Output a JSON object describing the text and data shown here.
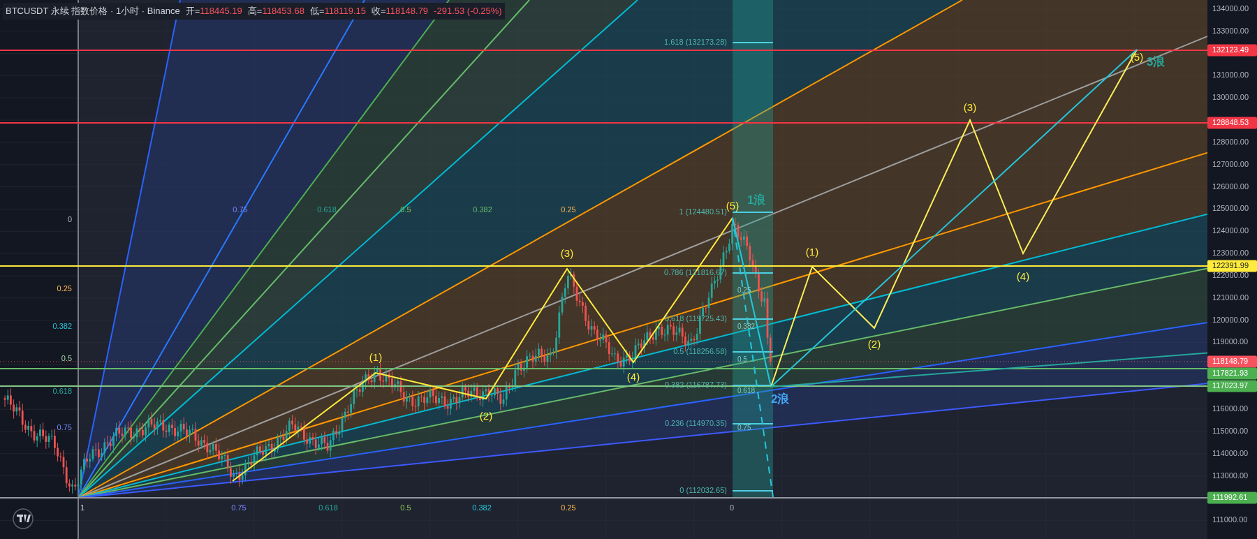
{
  "legend": {
    "title": "BTCUSDT 永续 指数价格 · 1小时 · Binance",
    "ohlc": [
      {
        "label": "开=",
        "value": "118445.19"
      },
      {
        "label": "高=",
        "value": "118453.68"
      },
      {
        "label": "低=",
        "value": "118119.15"
      },
      {
        "label": "收=",
        "value": "118148.79"
      }
    ],
    "change": "-291.53 (-0.25%)"
  },
  "price_axis": {
    "ticks": [
      "134000.00",
      "133000.00",
      "131000.00",
      "130000.00",
      "128000.00",
      "127000.00",
      "126000.00",
      "125000.00",
      "124000.00",
      "123000.00",
      "122000.00",
      "121000.00",
      "120000.00",
      "119000.00",
      "116000.00",
      "115000.00",
      "114000.00",
      "113000.00",
      "111000.00"
    ],
    "badges": [
      {
        "value": "132123.49",
        "color": "#f23645"
      },
      {
        "value": "128848.53",
        "color": "#f23645"
      },
      {
        "value": "122391.99",
        "color": "#ffeb3b"
      },
      {
        "value": "118148.79",
        "color": "#f7525f"
      },
      {
        "value": "117821.93",
        "color": "#4caf50"
      },
      {
        "value": "117023.97",
        "color": "#4caf50"
      },
      {
        "value": "111992.61",
        "color": "#4caf50"
      }
    ]
  },
  "gann_box": {
    "top_labels": [
      "0.75",
      "0.618",
      "0.5",
      "0.382",
      "0.25"
    ],
    "left_labels": [
      "0",
      "0.25",
      "0.382",
      "0.5",
      "0.618",
      "0.75"
    ],
    "bottom_labels": [
      "1",
      "0.75",
      "0.618",
      "0.5",
      "0.382",
      "0.25",
      "0"
    ]
  },
  "fib_retracement": {
    "levels": [
      "1.618 (132173.28)",
      "1 (124480.51)",
      "0.786 (121816.67)",
      "0.618 (119725.43)",
      "0.5 (118256.58)",
      "0.382 (116787.73)",
      "0.236 (114970.35)",
      "0 (112032.65)"
    ],
    "box_labels": [
      "0.25",
      "0.382",
      "0.5",
      "0.618",
      "0.75"
    ]
  },
  "elliott_waves": {
    "impulse": [
      "(1)",
      "(2)",
      "(3)",
      "(4)",
      "(5)"
    ],
    "projection": [
      "(1)",
      "(2)",
      "(3)",
      "(4)",
      "(5)"
    ],
    "wave_names": [
      "1浪",
      "2浪",
      "3浪"
    ]
  }
}
